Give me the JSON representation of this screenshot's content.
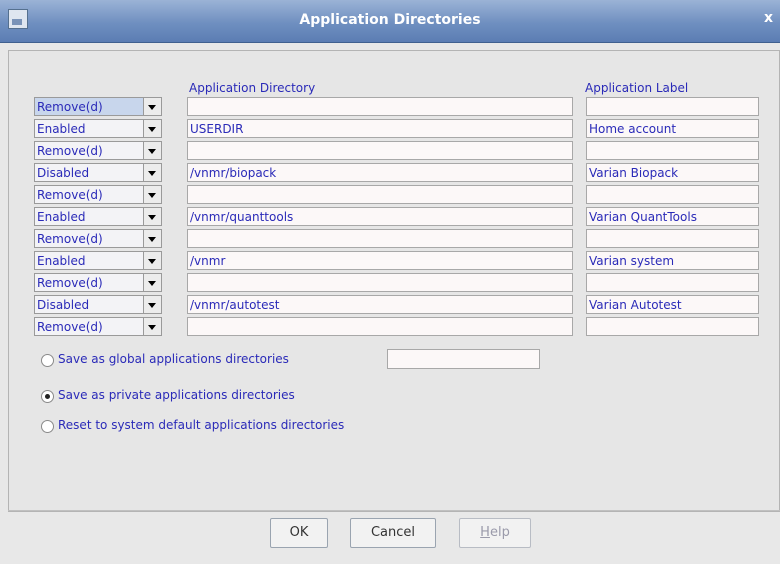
{
  "window": {
    "title": "Application Directories",
    "close_glyph": "x"
  },
  "columns": {
    "directory": "Application Directory",
    "label": "Application Label"
  },
  "rows": [
    {
      "status": "Remove(d)",
      "dir": "",
      "label": "",
      "selected": true
    },
    {
      "status": "Enabled",
      "dir": "USERDIR",
      "label": "Home account"
    },
    {
      "status": "Remove(d)",
      "dir": "",
      "label": ""
    },
    {
      "status": "Disabled",
      "dir": "/vnmr/biopack",
      "label": "Varian Biopack"
    },
    {
      "status": "Remove(d)",
      "dir": "",
      "label": ""
    },
    {
      "status": "Enabled",
      "dir": "/vnmr/quanttools",
      "label": "Varian QuantTools"
    },
    {
      "status": "Remove(d)",
      "dir": "",
      "label": ""
    },
    {
      "status": "Enabled",
      "dir": "/vnmr",
      "label": "Varian system"
    },
    {
      "status": "Remove(d)",
      "dir": "",
      "label": ""
    },
    {
      "status": "Disabled",
      "dir": "/vnmr/autotest",
      "label": "Varian Autotest"
    },
    {
      "status": "Remove(d)",
      "dir": "",
      "label": ""
    }
  ],
  "options": [
    {
      "label": "Save as global applications directories",
      "checked": false
    },
    {
      "label": "Save as private applications directories",
      "checked": true
    },
    {
      "label": "Reset to system default applications directories",
      "checked": false
    }
  ],
  "global_value": "",
  "buttons": {
    "ok": "OK",
    "cancel": "Cancel",
    "help_first": "H",
    "help_rest": "elp"
  },
  "colors": {
    "label_text": "#2a2ab8",
    "title_bar": "#6f8fc0"
  }
}
